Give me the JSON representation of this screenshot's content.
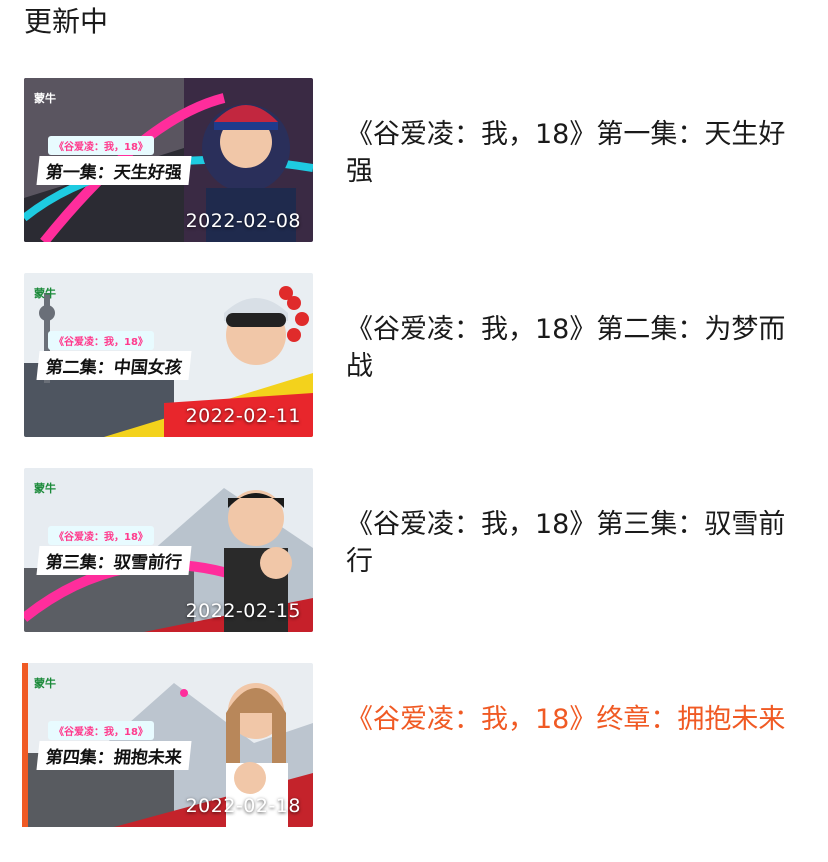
{
  "header": {
    "title": "更新中"
  },
  "accent_color": "#f05a24",
  "episodes": [
    {
      "title": "《谷爱凌：我，18》第一集：天生好强",
      "date": "2022-02-08",
      "thumbnail": {
        "brand": "蒙牛",
        "series": "《谷爱凌：我，18》",
        "episode_label": "第一集：天生好强"
      },
      "active": false
    },
    {
      "title": "《谷爱凌：我，18》第二集：为梦而战",
      "date": "2022-02-11",
      "thumbnail": {
        "brand": "蒙牛",
        "series": "《谷爱凌：我，18》",
        "episode_label": "第二集：中国女孩"
      },
      "active": false
    },
    {
      "title": "《谷爱凌：我，18》第三集：驭雪前行",
      "date": "2022-02-15",
      "thumbnail": {
        "brand": "蒙牛",
        "series": "《谷爱凌：我，18》",
        "episode_label": "第三集：驭雪前行"
      },
      "active": false
    },
    {
      "title": "《谷爱凌：我，18》终章：拥抱未来",
      "date": "2022-02-18",
      "thumbnail": {
        "brand": "蒙牛",
        "series": "《谷爱凌：我，18》",
        "episode_label": "第四集：拥抱未来"
      },
      "active": true
    }
  ]
}
